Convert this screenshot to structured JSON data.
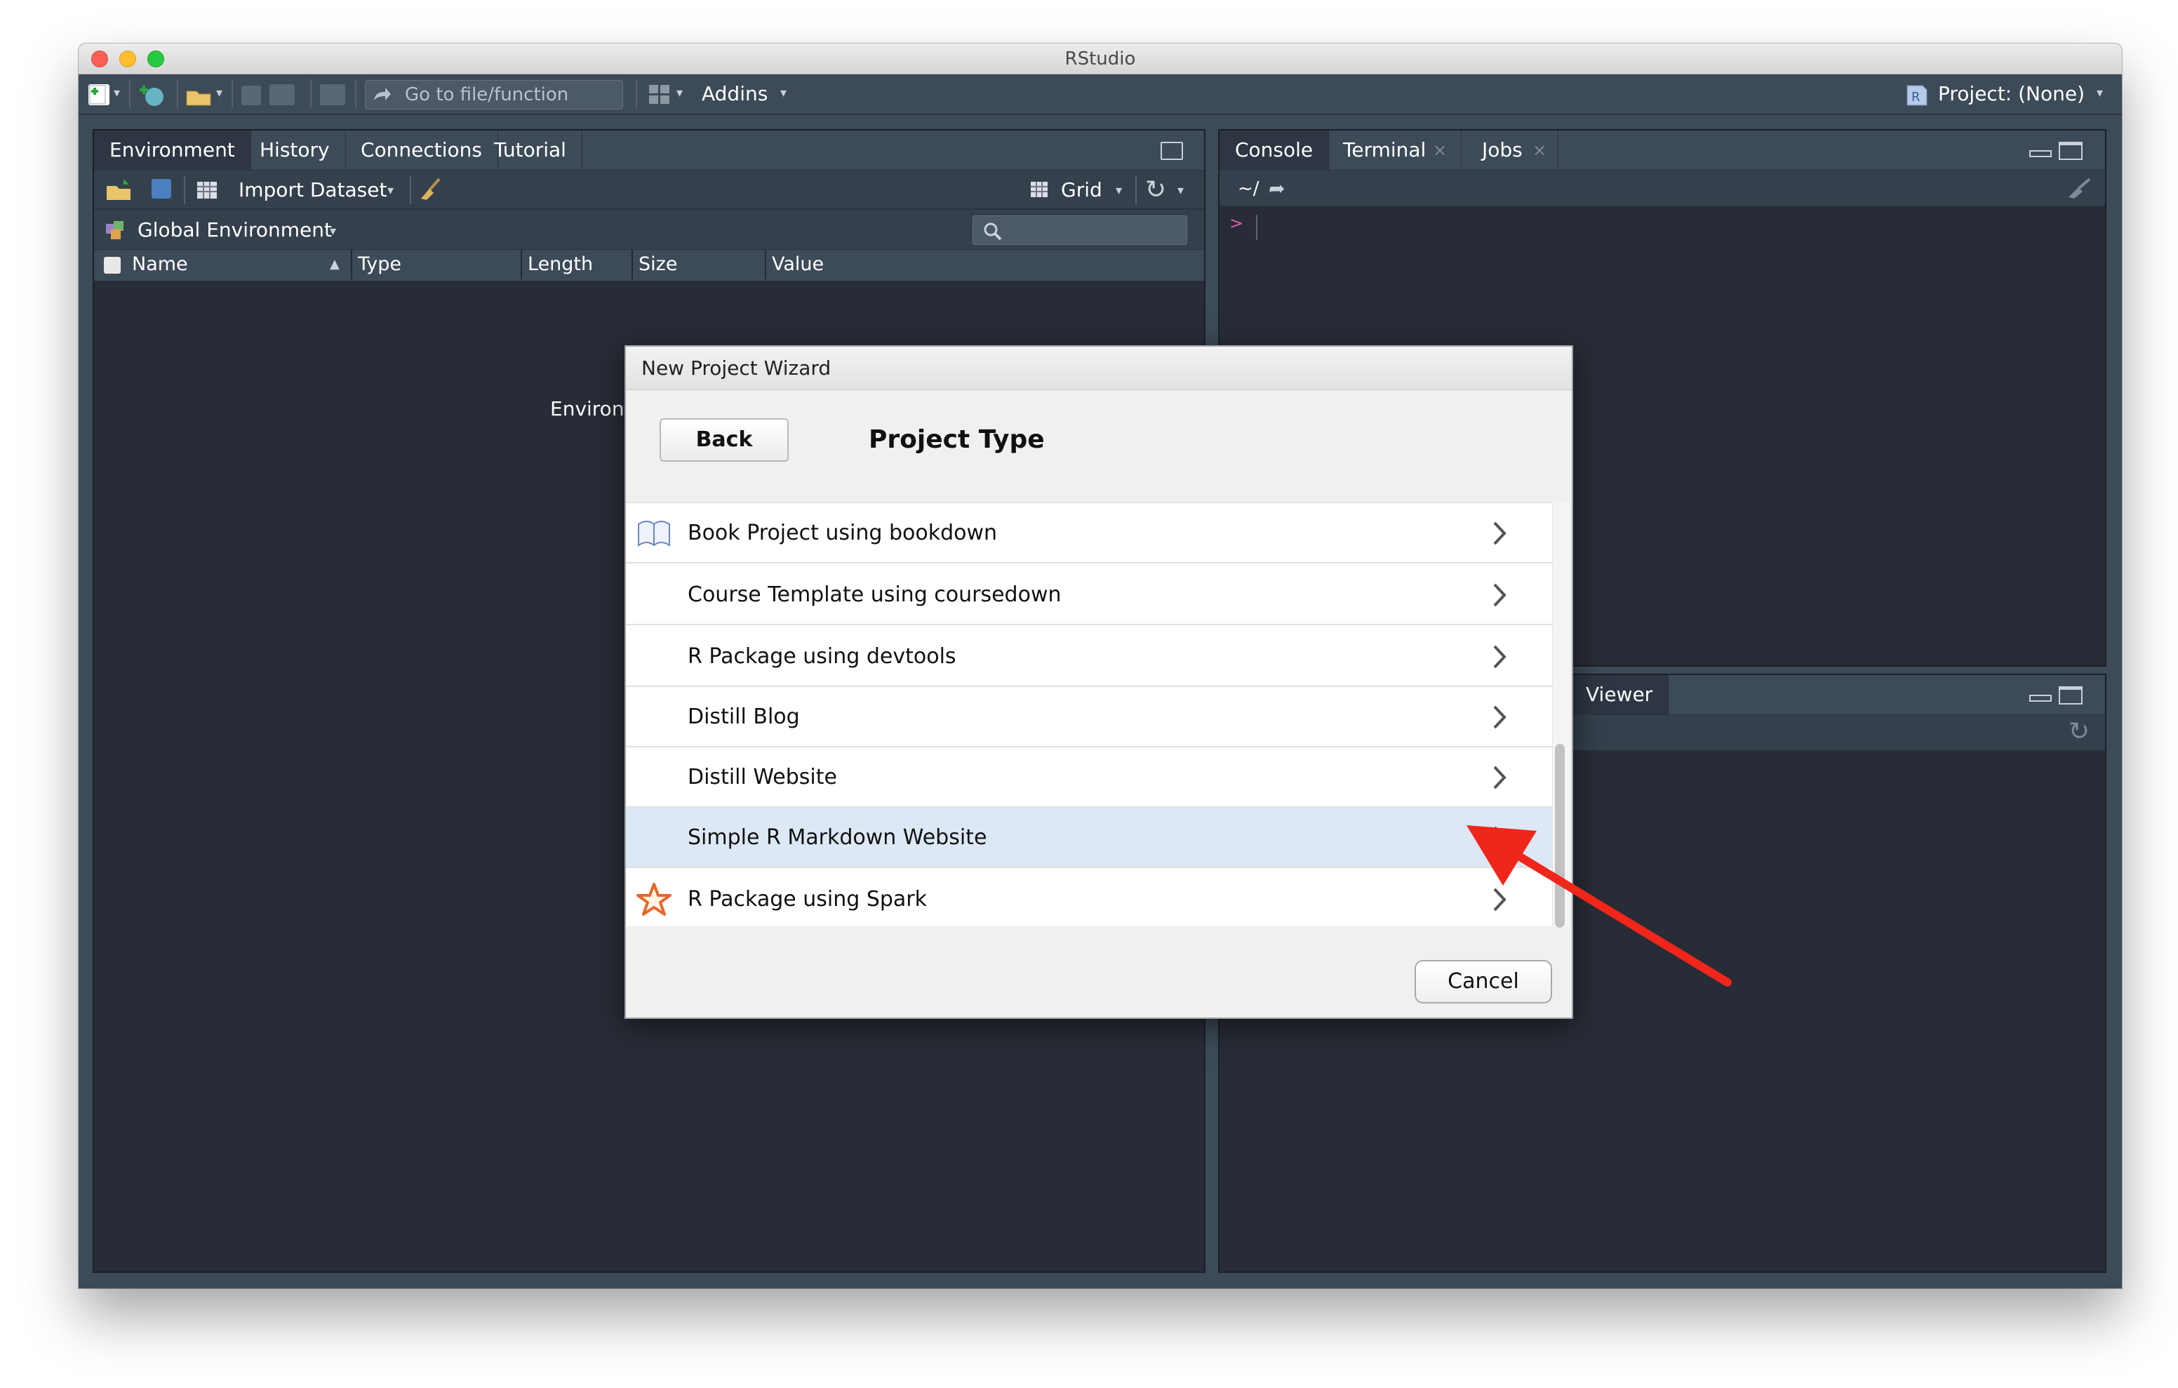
{
  "window": {
    "title": "RStudio"
  },
  "toolbar": {
    "goto_placeholder": "Go to file/function",
    "addins_label": "Addins",
    "project_label": "Project: (None)"
  },
  "env_pane": {
    "tabs": [
      "Environment",
      "History",
      "Connections",
      "Tutorial"
    ],
    "import_dataset_label": "Import Dataset",
    "grid_label": "Grid",
    "global_env_label": "Global Environment",
    "columns": [
      "Name",
      "Type",
      "Length",
      "Size",
      "Value"
    ],
    "empty_text": "Environment is empty"
  },
  "console_pane": {
    "tabs": [
      "Console",
      "Terminal",
      "Jobs"
    ],
    "path": "~/",
    "prompt": ">"
  },
  "viewer_pane": {
    "tab": "Viewer"
  },
  "dialog": {
    "title": "New Project Wizard",
    "back_label": "Back",
    "heading": "Project Type",
    "items": [
      {
        "label": "Book Project using bookdown",
        "icon": "book-icon"
      },
      {
        "label": "Course Template using coursedown",
        "icon": ""
      },
      {
        "label": "R Package using devtools",
        "icon": ""
      },
      {
        "label": "Distill Blog",
        "icon": ""
      },
      {
        "label": "Distill Website",
        "icon": ""
      },
      {
        "label": "Simple R Markdown Website",
        "icon": "",
        "selected": true
      },
      {
        "label": "R Package using Spark",
        "icon": "star-icon"
      }
    ],
    "cancel_label": "Cancel"
  },
  "annotation": {
    "arrow_color": "#f0261b"
  },
  "colors": {
    "toolbar_bg": "#3d4a57",
    "pane_bg": "#282c36",
    "selected_row": "#dde8f6",
    "console_prompt": "#e05ab0"
  }
}
